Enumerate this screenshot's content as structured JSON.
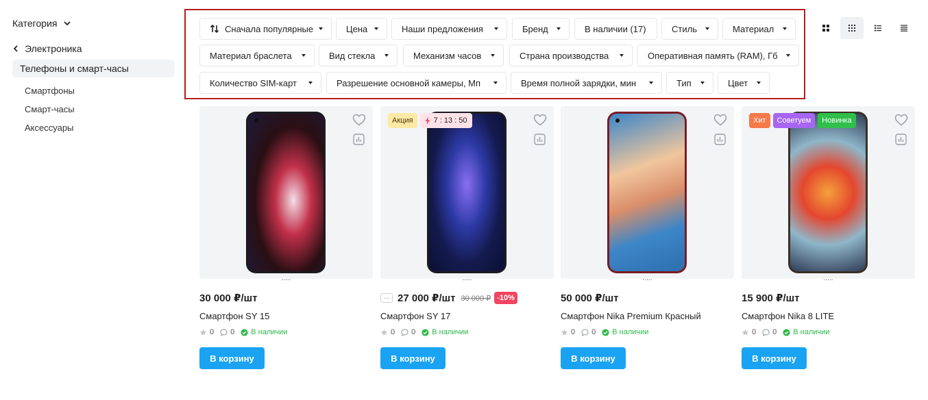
{
  "sidebar": {
    "category_label": "Категория",
    "back_label": "Электроника",
    "active_item": "Телефоны и смарт-часы",
    "subitems": [
      "Смартфоны",
      "Смарт-часы",
      "Аксессуары"
    ]
  },
  "filters": {
    "sort": "Сначала популярные",
    "chips": [
      "Цена",
      "Наши предложения",
      "Бренд",
      "В наличии (17)",
      "Стиль",
      "Материал",
      "Материал браслета",
      "Вид стекла",
      "Механизм часов",
      "Страна производства",
      "Оперативная память (RAM), Гб",
      "Количество SIM-карт",
      "Разрешение основной камеры, Мп",
      "Время полной зарядки, мин",
      "Тип",
      "Цвет"
    ]
  },
  "view_modes": [
    "tile-large-icon",
    "tile-small-icon",
    "list-icon",
    "list-compact-icon"
  ],
  "products": [
    {
      "price": "30 000 ₽/шт",
      "old_price": "",
      "discount": "",
      "title": "Смартфон SY 15",
      "rating": "0",
      "reviews": "0",
      "stock": "В наличии",
      "badges": [],
      "timer": "",
      "screen_colors": [
        "#2a0f14",
        "#c2304a",
        "#f3dfe8",
        "#1c1b3a"
      ]
    },
    {
      "price": "27 000 ₽/шт",
      "old_price": "30 000 ₽",
      "discount": "-10%",
      "title": "Смартфон SY 17",
      "rating": "0",
      "reviews": "0",
      "stock": "В наличии",
      "badges": [
        {
          "label": "Акция",
          "color": "#fde9a6",
          "text_color": "#4a3b00"
        }
      ],
      "timer": "7 : 13 : 50",
      "screen_colors": [
        "#0b1034",
        "#2d3aa6",
        "#8a6ff2",
        "#141a4d"
      ]
    },
    {
      "price": "50 000 ₽/шт",
      "old_price": "",
      "discount": "",
      "title": "Смартфон Nika Premium Красный",
      "rating": "0",
      "reviews": "0",
      "stock": "В наличии",
      "badges": [],
      "timer": "",
      "screen_colors": [
        "#3c86c8",
        "#f1c69d",
        "#d98e6a",
        "#2e6fae"
      ]
    },
    {
      "price": "15 900 ₽/шт",
      "old_price": "",
      "discount": "",
      "title": "Смартфон Nika 8 LITE",
      "rating": "0",
      "reviews": "0",
      "stock": "В наличии",
      "badges": [
        {
          "label": "Хит",
          "color": "#f47a4a",
          "text_color": "#ffffff"
        },
        {
          "label": "Советуем",
          "color": "#a766f2",
          "text_color": "#ffffff"
        },
        {
          "label": "Новинка",
          "color": "#2fbf4a",
          "text_color": "#ffffff"
        }
      ],
      "timer": "",
      "screen_colors": [
        "#2f3b55",
        "#e4472f",
        "#f4a13a",
        "#8fb6c9"
      ]
    }
  ],
  "cart_label": "В корзину"
}
